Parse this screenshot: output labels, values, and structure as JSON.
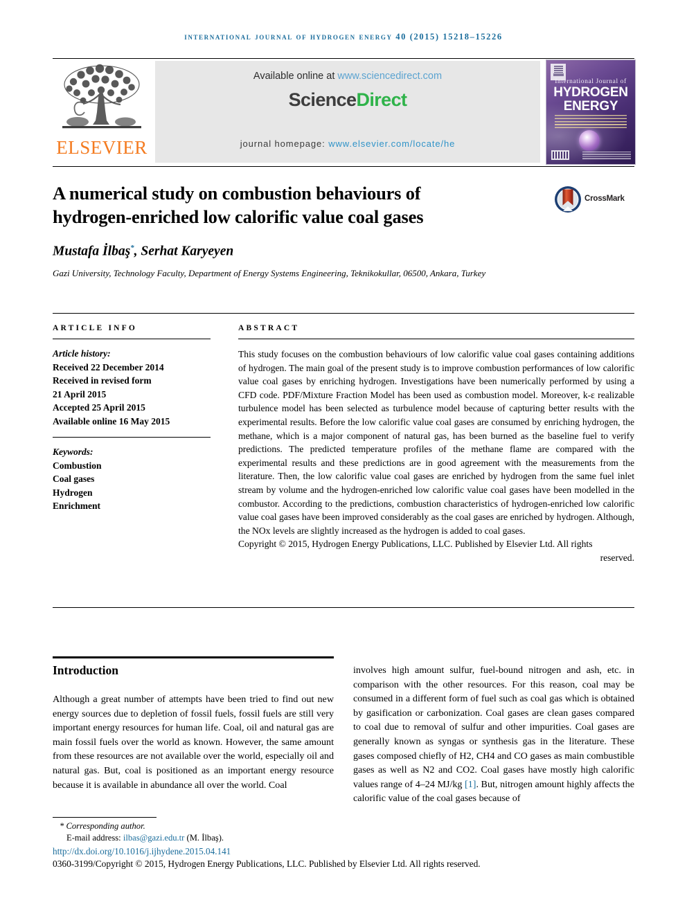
{
  "running_head": "International Journal of Hydrogen Energy 40 (2015) 15218–15226",
  "masthead": {
    "publisher_name": "ELSEVIER",
    "publisher_logo_alt": "elsevier-tree-logo",
    "available_prefix": "Available online at ",
    "available_link": "www.sciencedirect.com",
    "brand_part1": "Science",
    "brand_part2": "Direct",
    "homepage_prefix": "journal homepage: ",
    "homepage_link": "www.elsevier.com/locate/he",
    "cover": {
      "line_small": "International Journal of",
      "line_big_1": "HYDROGEN",
      "line_big_2": "ENERGY"
    },
    "colors": {
      "link_blue": "#2f93c8",
      "science_grey": "#3d3d3d",
      "direct_green": "#2fb34a",
      "elsevier_orange": "#f47b20",
      "band_grey": "#e7e7e7"
    }
  },
  "article": {
    "title": "A numerical study on combustion behaviours of hydrogen-enriched low calorific value coal gases",
    "crossmark_label": "CrossMark",
    "authors": "Mustafa İlbaş",
    "authors_marker": "*",
    "authors_rest": ", Serhat Karyeyen",
    "affiliation": "Gazi University, Technology Faculty, Department of Energy Systems Engineering, Teknikokullar, 06500, Ankara, Turkey"
  },
  "info": {
    "heading": "ARTICLE INFO",
    "history_label": "Article history:",
    "history": [
      "Received 22 December 2014",
      "Received in revised form",
      "21 April 2015",
      "Accepted 25 April 2015",
      "Available online 16 May 2015"
    ],
    "keywords_label": "Keywords:",
    "keywords": [
      "Combustion",
      "Coal gases",
      "Hydrogen",
      "Enrichment"
    ]
  },
  "abstract": {
    "heading": "ABSTRACT",
    "body": "This study focuses on the combustion behaviours of low calorific value coal gases containing additions of hydrogen. The main goal of the present study is to improve combustion performances of low calorific value coal gases by enriching hydrogen. Investigations have been numerically performed by using a CFD code. PDF/Mixture Fraction Model has been used as combustion model. Moreover, k-ε realizable turbulence model has been selected as turbulence model because of capturing better results with the experimental results. Before the low calorific value coal gases are consumed by enriching hydrogen, the methane, which is a major component of natural gas, has been burned as the baseline fuel to verify predictions. The predicted temperature profiles of the methane flame are compared with the experimental results and these predictions are in good agreement with the measurements from the literature. Then, the low calorific value coal gases are enriched by hydrogen from the same fuel inlet stream by volume and the hydrogen-enriched low calorific value coal gases have been modelled in the combustor. According to the predictions, combustion characteristics of hydrogen-enriched low calorific value coal gases have been improved considerably as the coal gases are enriched by hydrogen. Although, the NOx levels are slightly increased as the hydrogen is added to coal gases.",
    "copyright": "Copyright © 2015, Hydrogen Energy Publications, LLC. Published by Elsevier Ltd. All rights",
    "copyright_last": "reserved."
  },
  "body": {
    "section_heading": "Introduction",
    "left_column": "Although a great number of attempts have been tried to find out new energy sources due to depletion of fossil fuels, fossil fuels are still very important energy resources for human life. Coal, oil and natural gas are main fossil fuels over the world as known. However, the same amount from these resources are not available over the world, especially oil and natural gas. But, coal is positioned as an important energy resource because it is available in abundance all over the world. Coal",
    "right_column_part1": "involves high amount sulfur, fuel-bound nitrogen and ash, etc. in comparison with the other resources. For this reason, coal may be consumed in a different form of fuel such as coal gas which is obtained by gasification or carbonization. Coal gases are clean gases compared to coal due to removal of sulfur and other impurities. Coal gases are generally known as syngas or synthesis gas in the literature. These gases composed chiefly of H2, CH4 and CO gases as main combustible gases as well as N2 and CO2. Coal gases have mostly high calorific values range of 4–24 MJ/kg ",
    "right_column_ref": "[1]",
    "right_column_part2": ". But, nitrogen amount highly affects the calorific value of the coal gases because of"
  },
  "footnote": {
    "corresponding": "* Corresponding author.",
    "email_label": "E-mail address: ",
    "email": "ilbas@gazi.edu.tr",
    "email_suffix": " (M. İlbaş).",
    "doi": "http://dx.doi.org/10.1016/j.ijhydene.2015.04.141",
    "issn_line": "0360-3199/Copyright © 2015, Hydrogen Energy Publications, LLC. Published by Elsevier Ltd. All rights reserved."
  }
}
